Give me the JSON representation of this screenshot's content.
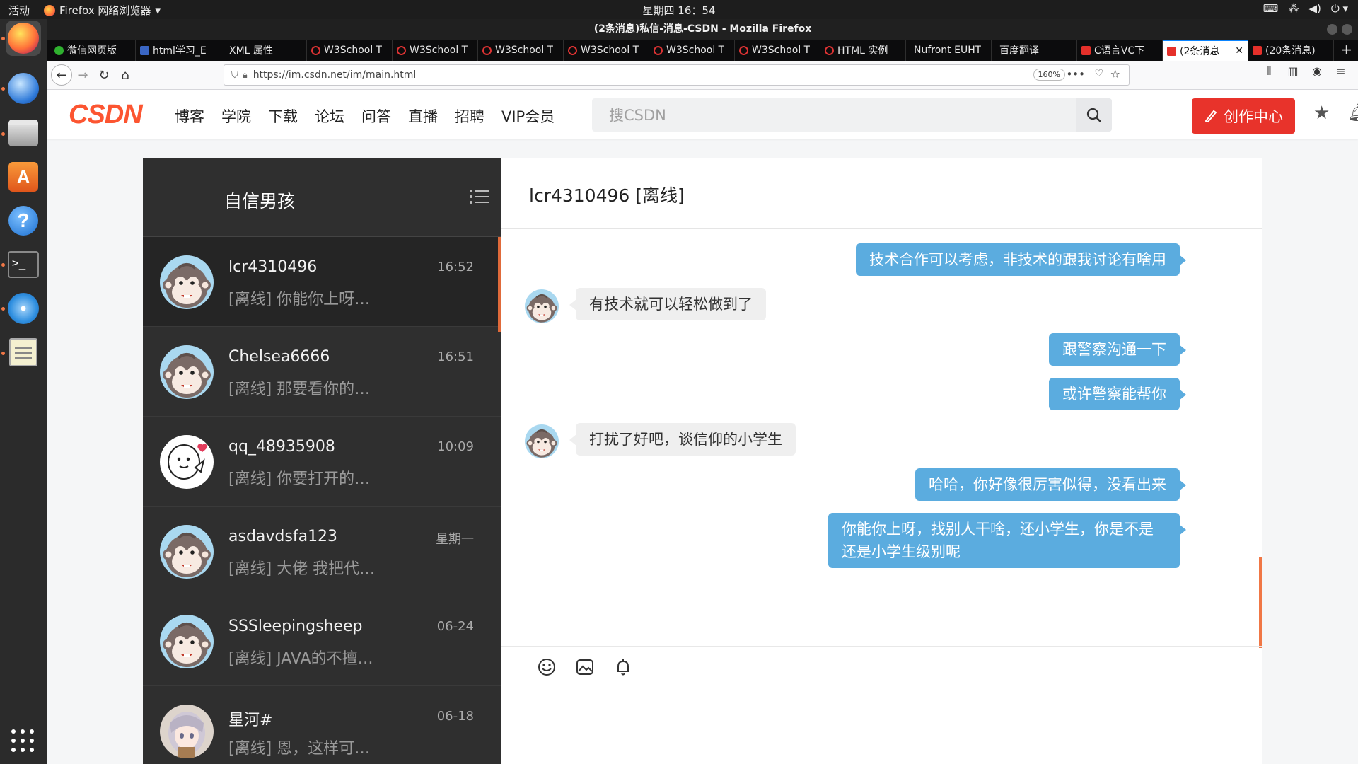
{
  "system": {
    "activities": "活动",
    "app_menu": "Firefox 网络浏览器",
    "clock": "星期四 16：54"
  },
  "window": {
    "title": "(2条消息)私信-消息-CSDN - Mozilla Firefox"
  },
  "tabs": [
    {
      "label": "微信网页版",
      "favicon": "wechat"
    },
    {
      "label": "html学习_E",
      "favicon": "html"
    },
    {
      "label": "XML 属性",
      "favicon": "none"
    },
    {
      "label": "W3School T",
      "favicon": "w3school"
    },
    {
      "label": "W3School T",
      "favicon": "w3school"
    },
    {
      "label": "W3School T",
      "favicon": "w3school"
    },
    {
      "label": "W3School T",
      "favicon": "w3school"
    },
    {
      "label": "W3School T",
      "favicon": "w3school"
    },
    {
      "label": "W3School T",
      "favicon": "w3school"
    },
    {
      "label": "HTML 实例",
      "favicon": "w3school"
    },
    {
      "label": "Nufront EUHT",
      "favicon": "none"
    },
    {
      "label": "百度翻译",
      "favicon": "none"
    },
    {
      "label": "C语言VC下",
      "favicon": "csdn"
    },
    {
      "label": "(2条消息",
      "favicon": "csdn",
      "active": true
    },
    {
      "label": "(20条消息)",
      "favicon": "csdn"
    }
  ],
  "urlbar": {
    "url": "https://im.csdn.net/im/main.html",
    "zoom": "160%"
  },
  "csdn": {
    "logo": "CSDN",
    "nav": [
      "博客",
      "学院",
      "下载",
      "论坛",
      "问答",
      "直播",
      "招聘",
      "VIP会员"
    ],
    "search_placeholder": "搜CSDN",
    "create_label": "创作中心"
  },
  "sidebar": {
    "current_user": "自信男孩"
  },
  "conversations": [
    {
      "name": "lcr4310496",
      "time": "16:52",
      "preview": "[离线] 你能你上呀…",
      "avatar": "monkey",
      "active": true
    },
    {
      "name": "Chelsea6666",
      "time": "16:51",
      "preview": "[离线] 那要看你的…",
      "avatar": "monkey"
    },
    {
      "name": "qq_48935908",
      "time": "10:09",
      "preview": "[离线] 你要打开的…",
      "avatar": "cartoon"
    },
    {
      "name": "asdavdsfa123",
      "time": "星期一",
      "preview": "[离线] 大佬 我把代…",
      "avatar": "monkey"
    },
    {
      "name": "SSSleepingsheep",
      "time": "06-24",
      "preview": "[离线] JAVA的不擅…",
      "avatar": "monkey"
    },
    {
      "name": "星河#",
      "time": "06-18",
      "preview": "[离线] 恩，这样可…",
      "avatar": "anime"
    }
  ],
  "chat": {
    "title": "lcr4310496 [离线]",
    "messages": [
      {
        "from": "me",
        "text": "技术合作可以考虑，非技术的跟我讨论有啥用"
      },
      {
        "from": "them",
        "text": "有技术就可以轻松做到了"
      },
      {
        "from": "me",
        "text": "跟警察沟通一下"
      },
      {
        "from": "me",
        "text": "或许警察能帮你"
      },
      {
        "from": "them",
        "text": "打扰了好吧，谈信仰的小学生"
      },
      {
        "from": "me",
        "text": "哈哈，你好像很厉害似得，没看出来"
      },
      {
        "from": "me",
        "text": "你能你上呀，找别人干啥，还小学生，你是不是还是小学生级别呢"
      }
    ]
  },
  "colors": {
    "csdn_red": "#fc5531",
    "my_bubble": "#5bacdf",
    "their_bubble": "#efefef",
    "accent_orange": "#f07745"
  }
}
